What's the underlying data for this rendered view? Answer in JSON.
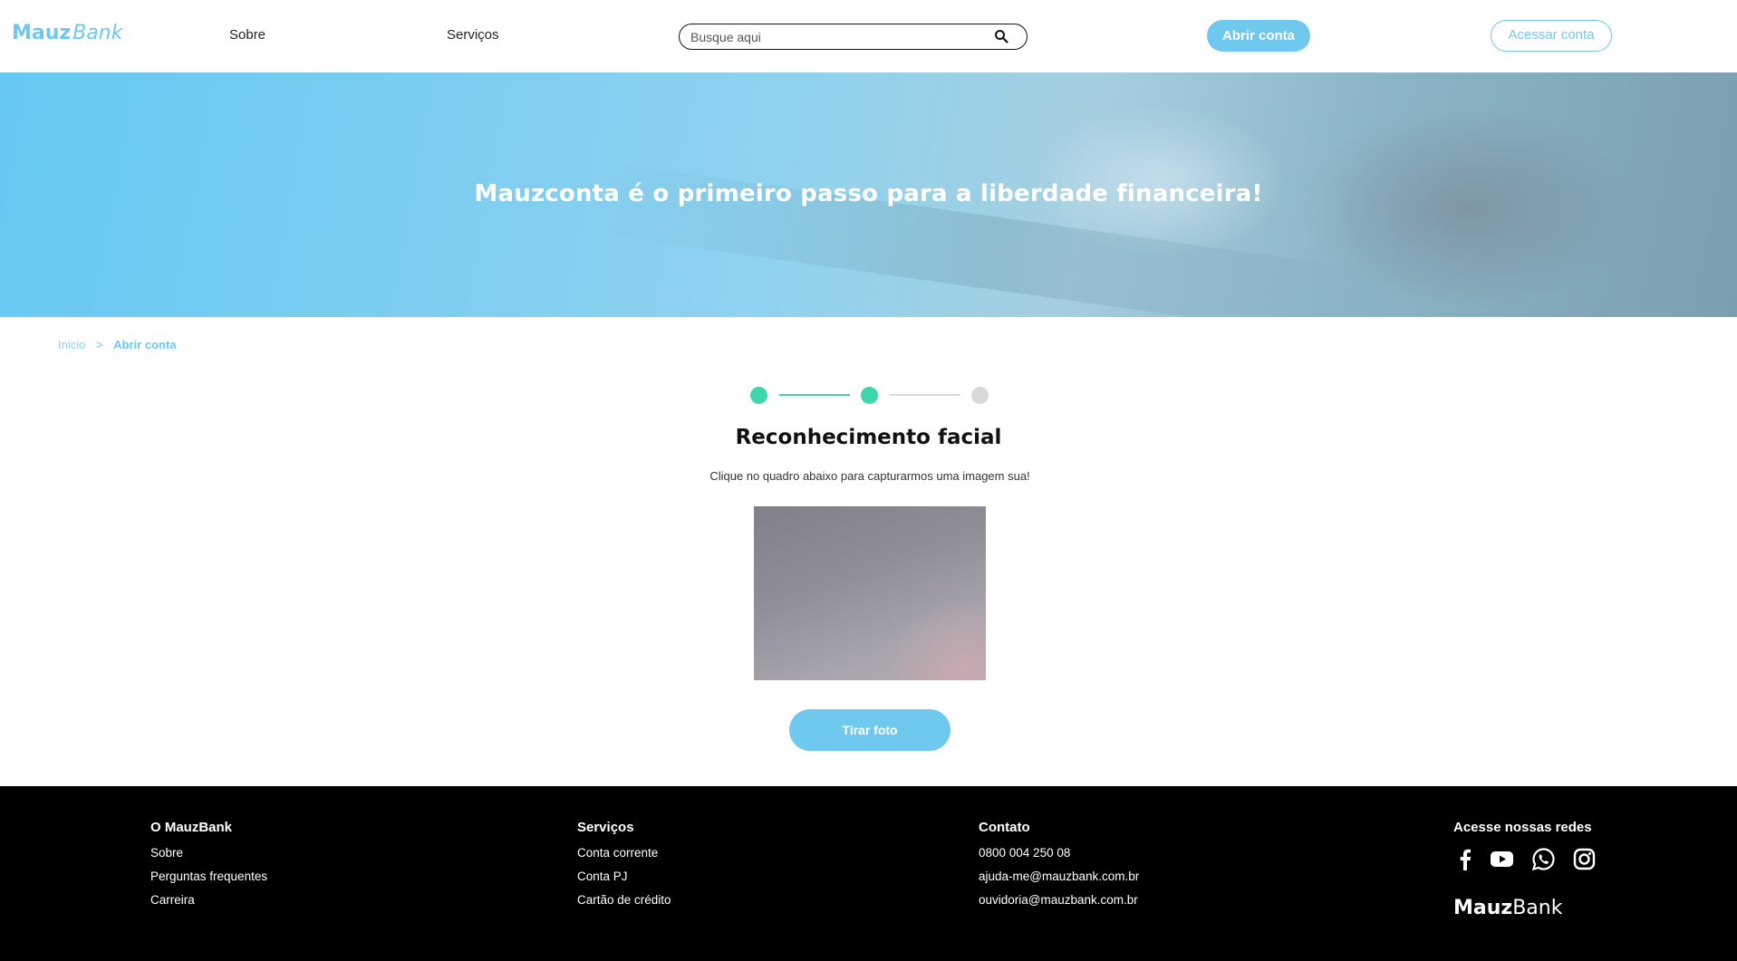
{
  "header": {
    "logo_part1": "Mauz",
    "logo_part2": "Bank",
    "nav": {
      "sobre": "Sobre",
      "servicos": "Serviços"
    },
    "search": {
      "placeholder": "Busque aqui",
      "value": "",
      "icon": "search-icon"
    },
    "btn_abrir_conta": "Abrir conta",
    "btn_acessar_conta": "Acessar conta"
  },
  "hero": {
    "title": "Mauzconta é o primeiro passo para a liberdade financeira!"
  },
  "breadcrumb": {
    "home": "Inicio",
    "separator": ">",
    "current": "Abrir conta"
  },
  "stepper": {
    "total_steps": 3,
    "completed_steps": 2,
    "active_color": "#3fd6ac",
    "inactive_color": "#d9d9d9"
  },
  "main": {
    "title": "Reconhecimento facial",
    "instruction": "Clique no quadro abaixo para capturarmos uma imagem sua!",
    "btn_tirar_foto": "Tirar foto"
  },
  "footer": {
    "col1": {
      "title": "O MauzBank",
      "items": [
        "Sobre",
        "Perguntas frequentes",
        "Carreira"
      ]
    },
    "col2": {
      "title": "Serviços",
      "items": [
        "Conta corrente",
        "Conta PJ",
        "Cartão de crédito"
      ]
    },
    "col3": {
      "title": "Contato",
      "items": [
        "0800 004 250 08",
        "ajuda-me@mauzbank.com.br",
        "ouvidoria@mauzbank.com.br"
      ]
    },
    "col4": {
      "title": "Acesse nossas redes",
      "socials": [
        "facebook-icon",
        "youtube-icon",
        "whatsapp-icon",
        "instagram-icon"
      ]
    },
    "logo_part1": "Mauz",
    "logo_part2": "Bank"
  },
  "colors": {
    "brand": "#6fc8ee",
    "success": "#3fd6ac",
    "footer_bg": "#000000"
  }
}
